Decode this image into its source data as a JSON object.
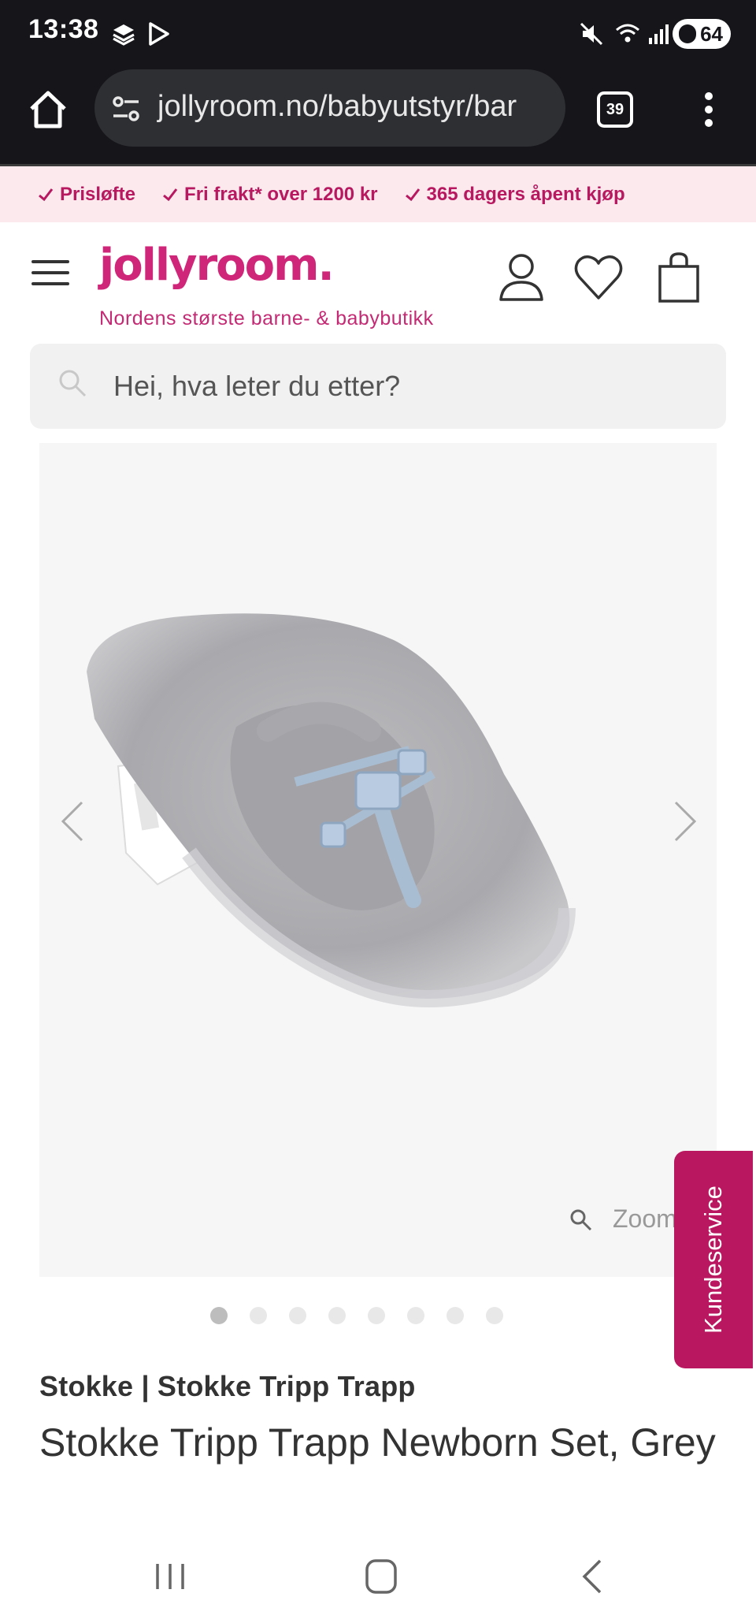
{
  "status": {
    "time": "13:38",
    "battery": "64"
  },
  "browser": {
    "url": "jollyroom.no/babyutstyr/bar",
    "tabs": "39"
  },
  "usp": [
    "Prisløfte",
    "Fri frakt* over 1200 kr",
    "365 dagers åpent kjøp"
  ],
  "header": {
    "logo": "jollyroom.",
    "tagline": "Nordens største barne- & babybutikk"
  },
  "search": {
    "placeholder": "Hei, hva leter du etter?"
  },
  "gallery": {
    "zoom_label": "Zoom",
    "image_count": 8,
    "active_index": 0
  },
  "customer_service": {
    "label": "Kundeservice"
  },
  "product": {
    "brand": "Stokke | Stokke Tripp Trapp",
    "title": "Stokke Tripp Trapp Newborn Set, Grey"
  },
  "colors": {
    "brand_pink": "#d0267a",
    "usp_bg": "#fbe9ee",
    "kunde_bg": "#b9175f"
  }
}
